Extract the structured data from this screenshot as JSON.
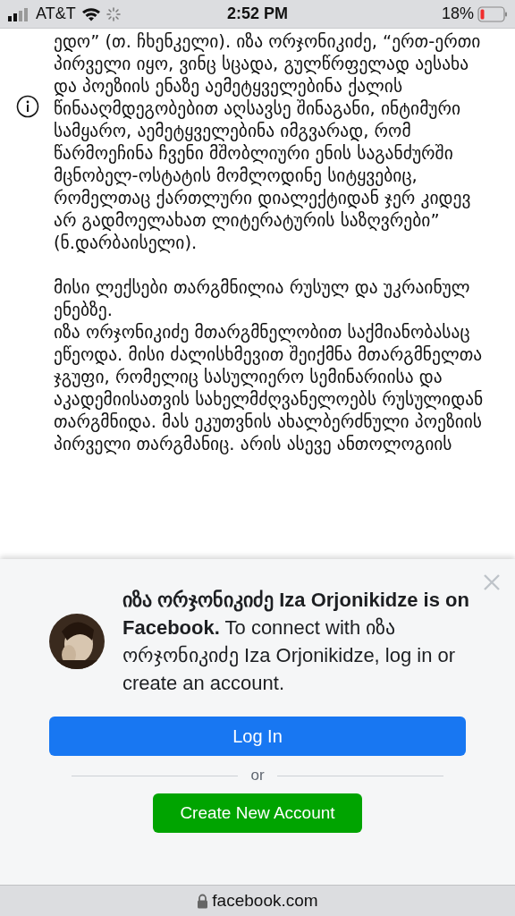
{
  "status_bar": {
    "carrier": "AT&T",
    "time": "2:52 PM",
    "battery": "18%"
  },
  "article": {
    "paragraphs": [
      "ედო” (თ. ჩხენკელი). იზა ორჯონიკიძე, “ერთ-ერთი პირველი იყო, ვინც სცადა, გულწრფელად აესახა და პოეზიის ენაზე აემეტყველებინა ქალის წინააღმდეგობებით აღსავსე შინაგანი, ინტიმური სამყარო, აემეტყველებინა იმგვარად, რომ წარმოეჩინა ჩვენი მშობლიური ენის საგანძურში მცნობელ-ოსტატის მომლოდინე სიტყვებიც, რომელთაც ქართლური დიალექტიდან ჯერ კიდევ არ გადმოელახათ ლიტერატურის საზღვრები” (ნ.დარბაისელი).",
      "მისი ლექსები თარგმნილია რუსულ და უკრაინულ ენებზე.",
      "იზა ორჯონიკიძე მთარგმნელობით საქმიანობასაც ეწეოდა. მისი ძალისხმევით შეიქმნა მთარგმნელთა ჯგუფი, რომელიც სასულიერო სემინარიისა და აკადემიისათვის სახელმძღვანელოებს რუსულიდან თარგმნიდა. მას ეკუთვნის ახალბერძნული პოეზიის პირველი თარგმანიც. არის ასევე ანთოლოგიის"
    ]
  },
  "login_prompt": {
    "message": "**იზა ორჯონიკიძე Iza Orjonikidze is on Facebook.** To connect with იზა ორჯონიკიძე Iza Orjonikidze, log in or create an account.",
    "login_button": "Log In",
    "divider": "or",
    "create_button": "Create New Account"
  },
  "address_bar": {
    "url": "facebook.com"
  }
}
